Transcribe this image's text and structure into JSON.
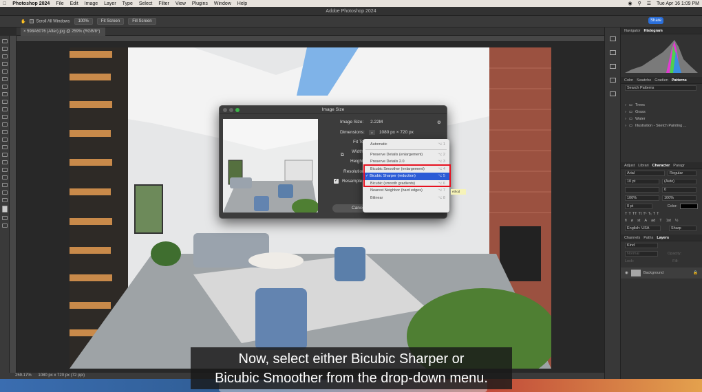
{
  "menubar": {
    "app": "Photoshop 2024",
    "items": [
      "File",
      "Edit",
      "Image",
      "Layer",
      "Type",
      "Select",
      "Filter",
      "View",
      "Plugins",
      "Window",
      "Help"
    ],
    "clock": "Tue Apr 16  1:09 PM"
  },
  "window": {
    "title": "Adobe Photoshop 2024",
    "share": "Share"
  },
  "options": {
    "scroll_all": "Scroll All Windows",
    "zoom": "100%",
    "fit": "Fit Screen",
    "fill": "Fill Screen"
  },
  "document": {
    "tab": "598A6076 (After).jpg @ 259% (RGB/8*)"
  },
  "status": {
    "zoom": "259.17%",
    "size": "1080 px x 720 px (72 ppi)"
  },
  "panels": {
    "top_tabs": [
      "Navigator",
      "Histogram"
    ],
    "mid_tabs": [
      "Color",
      "Swatche",
      "Gradien",
      "Patterns"
    ],
    "pattern_search": "Search Patterns",
    "pattern_folders": [
      "Trees",
      "Grass",
      "Water",
      "Illustration - Sketch Painting ..."
    ],
    "char_tabs": [
      "Adjust",
      "Librari",
      "Character",
      "Paragr"
    ],
    "font": "Arial",
    "style": "Regular",
    "size": "10 pt",
    "leading": "(Auto)",
    "v1": "0",
    "v2": "100%",
    "v3": "100%",
    "v4": "0 pt",
    "color_label": "Color:",
    "lang": "English: USA",
    "aa": "Sharp",
    "layer_tabs": [
      "Channels",
      "Paths",
      "Layers"
    ],
    "kind": "Kind",
    "normal": "Normal",
    "opacity": "Opacity:",
    "lock": "Lock:",
    "fill": "Fill:",
    "layer_name": "Background"
  },
  "dialog": {
    "title": "Image Size",
    "image_size_label": "Image Size:",
    "image_size_value": "2.22M",
    "dimensions_label": "Dimensions:",
    "dimensions_value": "1080 px  ×  720 px",
    "fit_to": "Fit To:",
    "width": "Width:",
    "height": "Height:",
    "resolution": "Resolution:",
    "resample": "Resample:",
    "cancel": "Cancel"
  },
  "menu": {
    "items": [
      {
        "label": "Automatic",
        "key": "⌥ 1"
      },
      {
        "label": "Preserve Details (enlargement)",
        "key": "⌥ 2"
      },
      {
        "label": "Preserve Details 2.0",
        "key": "⌥ 3"
      },
      {
        "label": "Bicubic Smoother (enlargement)",
        "key": "⌥ 4"
      },
      {
        "label": "✓ Bicubic Sharper (reduction)",
        "key": "⌥ 5"
      },
      {
        "label": "Bicubic (smooth gradients)",
        "key": "⌥ 6"
      },
      {
        "label": "Nearest Neighbor (hard edges)",
        "key": "⌥ 7"
      },
      {
        "label": "Bilinear",
        "key": "⌥ 8"
      }
    ],
    "tooltip": "ethod"
  },
  "subtitle": {
    "line1": "Now, select either Bicubic Sharper or",
    "line2": "Bicubic Smoother from the drop-down menu."
  }
}
